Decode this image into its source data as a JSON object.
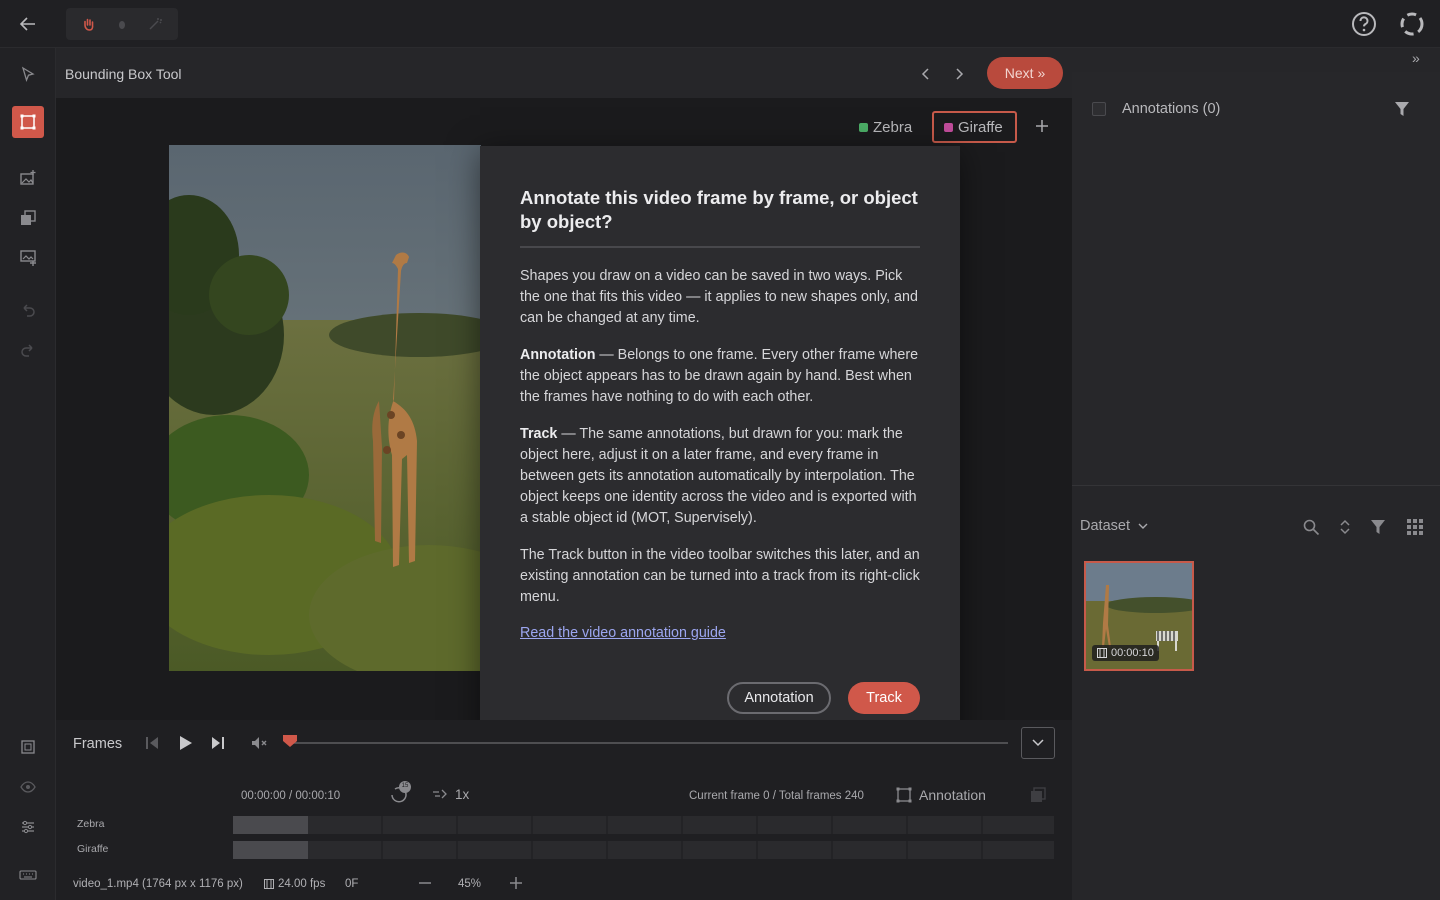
{
  "app": {
    "tool_name": "Bounding Box Tool",
    "next_label": "Next »"
  },
  "labels": [
    {
      "name": "Zebra",
      "color": "#4cae67"
    },
    {
      "name": "Giraffe",
      "color": "#c24d9c"
    }
  ],
  "dialog": {
    "title": "Annotate this video frame by frame, or object by object?",
    "intro": "Shapes you draw on a video can be saved in two ways. Pick the one that fits this video — it applies to new shapes only, and can be changed at any time.",
    "annotation_term": "Annotation",
    "annotation_desc": " — Belongs to one frame. Every other frame where the object appears has to be drawn again by hand. Best when the frames have nothing to do with each other.",
    "track_term": "Track",
    "track_desc": " — The same annotations, but drawn for you: mark the object here, adjust it on a later frame, and every frame in between gets its annotation automatically by interpolation. The object keeps one identity across the video and is exported with a stable object id (MOT, Supervisely).",
    "note": "The Track button in the video toolbar switches this later, and an existing annotation can be turned into a track from its right-click menu.",
    "guide_link": "Read the video annotation guide",
    "btn_annotation": "Annotation",
    "btn_track": "Track"
  },
  "player": {
    "frames_label": "Frames",
    "time": "00:00:00 / 00:00:10",
    "speed": "1x",
    "frame_info": "Current frame 0 / Total frames 240",
    "mode": "Annotation",
    "progress": 0,
    "tracks": [
      "Zebra",
      "Giraffe"
    ],
    "badge": "15"
  },
  "status": {
    "file": "video_1.mp4 (1764 px x 1176 px)",
    "fps": "24.00 fps",
    "frame": "0F",
    "zoom": "45%"
  },
  "right_panel": {
    "annotations_title": "Annotations (0)",
    "dataset_label": "Dataset",
    "thumb_duration": "00:00:10"
  },
  "colors": {
    "accent": "#d0584a"
  }
}
